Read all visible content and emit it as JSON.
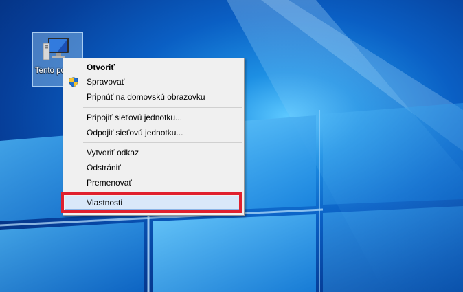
{
  "desktop": {
    "icon": {
      "name": "pc-icon",
      "label": "Tento počítač"
    }
  },
  "context_menu": {
    "items": [
      {
        "label": "Otvoriť",
        "bold": true
      },
      {
        "label": "Spravovať",
        "icon": "uac-shield-icon"
      },
      {
        "label": "Pripnúť na domovskú obrazovku"
      },
      {
        "label": "Pripojiť sieťovú jednotku..."
      },
      {
        "label": "Odpojiť sieťovú jednotku..."
      },
      {
        "label": "Vytvoriť odkaz"
      },
      {
        "label": "Odstrániť"
      },
      {
        "label": "Premenovať"
      },
      {
        "label": "Vlastnosti",
        "highlighted": true
      }
    ]
  },
  "colors": {
    "highlight_border": "#e0202e",
    "menu_background": "#f0f0f0",
    "hover_background": "#d9e8f9"
  }
}
